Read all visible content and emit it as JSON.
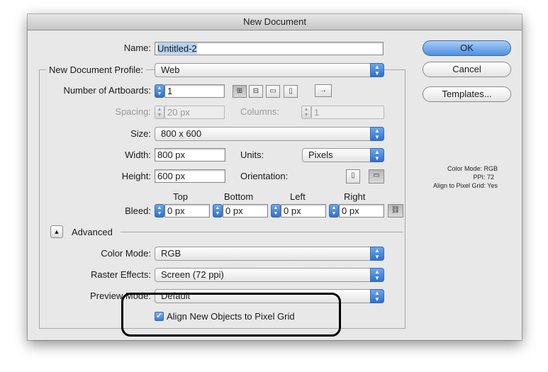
{
  "window": {
    "title": "New Document"
  },
  "name": {
    "label": "Name:",
    "value": "Untitled-2"
  },
  "profile": {
    "label": "New Document Profile:",
    "value": "Web"
  },
  "artboards": {
    "label": "Number of Artboards:",
    "value": "1",
    "arrange_icons": [
      "grid-by-row-icon",
      "grid-by-column-icon",
      "arrange-by-row-icon",
      "arrange-by-column-icon"
    ],
    "direction_icon": "→"
  },
  "spacing": {
    "label": "Spacing:",
    "value": "20 px"
  },
  "columns": {
    "label": "Columns:",
    "value": "1"
  },
  "size": {
    "label": "Size:",
    "value": "800 x 600"
  },
  "width": {
    "label": "Width:",
    "value": "800 px"
  },
  "units": {
    "label": "Units:",
    "value": "Pixels"
  },
  "height": {
    "label": "Height:",
    "value": "600 px"
  },
  "orientation": {
    "label": "Orientation:"
  },
  "bleed": {
    "label": "Bleed:",
    "headers": {
      "top": "Top",
      "bottom": "Bottom",
      "left": "Left",
      "right": "Right"
    },
    "values": {
      "top": "0 px",
      "bottom": "0 px",
      "left": "0 px",
      "right": "0 px"
    }
  },
  "advanced": {
    "label": "Advanced",
    "toggle_glyph": "▲"
  },
  "color_mode": {
    "label": "Color Mode:",
    "value": "RGB"
  },
  "raster_effects": {
    "label": "Raster Effects:",
    "value": "Screen (72 ppi)"
  },
  "preview_mode": {
    "label": "Preview Mode:",
    "value": "Default"
  },
  "align_pixel_grid": {
    "label": "Align New Objects to Pixel Grid",
    "checked": true
  },
  "buttons": {
    "ok": "OK",
    "cancel": "Cancel",
    "templates": "Templates..."
  },
  "summary": {
    "color_mode": "Color Mode: RGB",
    "ppi": "PPI: 72",
    "align": "Align to Pixel Grid: Yes"
  },
  "colors": {
    "accent": "#3f82dc",
    "dialog_bg": "#e8e8e8"
  }
}
